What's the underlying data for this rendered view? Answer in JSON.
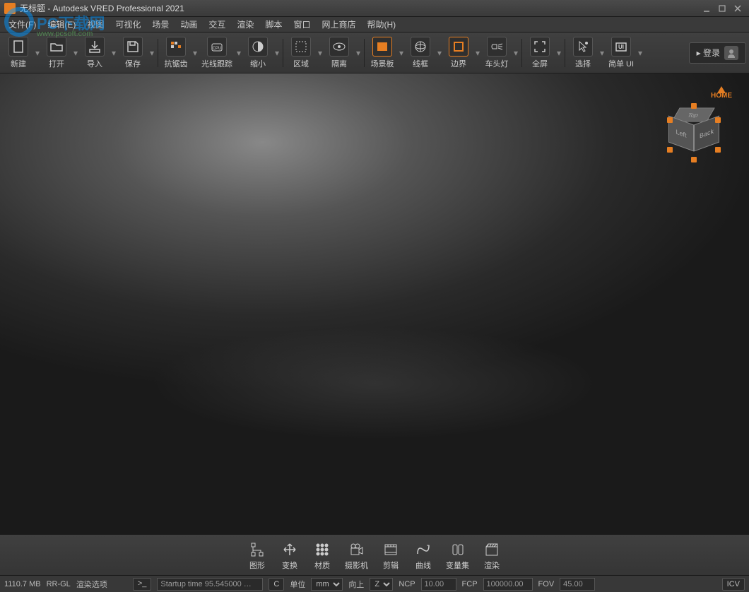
{
  "title": "无标题 - Autodesk VRED Professional 2021",
  "watermark": {
    "text": "PC下载网",
    "url": "www.pcsoft.com"
  },
  "menu": [
    "文件(F)",
    "编辑(E)",
    "视图",
    "可视化",
    "场景",
    "动画",
    "交互",
    "渲染",
    "脚本",
    "窗口",
    "网上商店",
    "帮助(H)"
  ],
  "toolbar": [
    {
      "label": "新建",
      "name": "new-button"
    },
    {
      "label": "打开",
      "name": "open-button"
    },
    {
      "label": "导入",
      "name": "import-button"
    },
    {
      "label": "保存",
      "name": "save-button"
    },
    {
      "label": "抗锯齿",
      "name": "antialias-button"
    },
    {
      "label": "光线跟踪",
      "name": "raytrace-button"
    },
    {
      "label": "缩小",
      "name": "downscale-button"
    },
    {
      "label": "区域",
      "name": "region-button"
    },
    {
      "label": "隔离",
      "name": "isolate-button"
    },
    {
      "label": "场景板",
      "name": "backplate-button"
    },
    {
      "label": "线框",
      "name": "wireframe-button"
    },
    {
      "label": "边界",
      "name": "boundary-button"
    },
    {
      "label": "车头灯",
      "name": "headlight-button"
    },
    {
      "label": "全屏",
      "name": "fullscreen-button"
    },
    {
      "label": "选择",
      "name": "select-button"
    },
    {
      "label": "简单 UI",
      "name": "simple-ui-button"
    }
  ],
  "login": {
    "label": "登录",
    "dropdown": "▾"
  },
  "navcube": {
    "home": "HOME",
    "left": "Left",
    "back": "Back",
    "top": "Top"
  },
  "bottom_toolbar": [
    {
      "label": "图形",
      "name": "scenegraph-button"
    },
    {
      "label": "变换",
      "name": "transform-button"
    },
    {
      "label": "材质",
      "name": "material-button"
    },
    {
      "label": "摄影机",
      "name": "camera-button"
    },
    {
      "label": "剪辑",
      "name": "clip-button"
    },
    {
      "label": "曲线",
      "name": "curve-button"
    },
    {
      "label": "变量集",
      "name": "variantset-button"
    },
    {
      "label": "渲染",
      "name": "render-button"
    }
  ],
  "status": {
    "memory": "1110.7 MB",
    "engine": "RR-GL",
    "options": "渲染选项",
    "terminal": "Startup time 95.545000 …",
    "c_btn": "C",
    "unit_label": "单位",
    "unit_value": "mm",
    "up_label": "向上",
    "up_value": "Z",
    "ncp_label": "NCP",
    "ncp_value": "10.00",
    "fcp_label": "FCP",
    "fcp_value": "100000.00",
    "fov_label": "FOV",
    "fov_value": "45.00",
    "icv": "ICV"
  }
}
